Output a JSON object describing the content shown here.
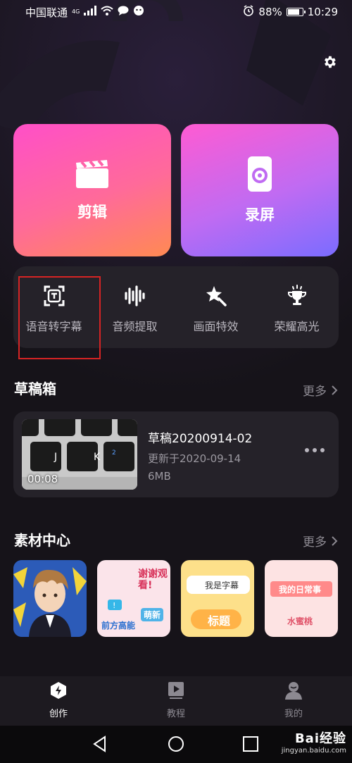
{
  "status_bar": {
    "carrier": "中国联通",
    "network": "4G",
    "battery": "88%",
    "battery_level": 0.88,
    "time": "10:29"
  },
  "main_cards": [
    {
      "label": "剪辑",
      "icon": "clapperboard-icon"
    },
    {
      "label": "录屏",
      "icon": "phone-record-icon"
    }
  ],
  "tools": [
    {
      "label": "语音转字幕",
      "icon": "text-recognition-icon"
    },
    {
      "label": "音频提取",
      "icon": "audio-wave-icon"
    },
    {
      "label": "画面特效",
      "icon": "magic-star-icon"
    },
    {
      "label": "荣耀高光",
      "icon": "trophy-icon"
    }
  ],
  "drafts": {
    "title": "草稿箱",
    "more": "更多",
    "item": {
      "name": "草稿20200914-02",
      "updated": "更新于2020-09-14",
      "size": "6MB",
      "duration": "00:08",
      "keys": [
        "J",
        "K",
        "2"
      ]
    }
  },
  "materials": {
    "title": "素材中心",
    "more": "更多",
    "items": [
      {
        "name": "anime-character"
      },
      {
        "name": "前方高能",
        "text": "前方高能",
        "text2": "谢谢观看!",
        "text3": "萌新"
      },
      {
        "name": "标题",
        "text": "我是字幕",
        "text2": "标题"
      },
      {
        "name": "水蜜桃",
        "text": "我的日常事",
        "text2": "水蜜桃"
      }
    ]
  },
  "bottom_nav": [
    {
      "label": "创作",
      "icon": "create-bolt-icon",
      "active": true
    },
    {
      "label": "教程",
      "icon": "tutorial-play-icon",
      "active": false
    },
    {
      "label": "我的",
      "icon": "profile-person-icon",
      "active": false
    }
  ],
  "watermark": {
    "text": "Bai经验",
    "sub": "jingyan.baidu.com"
  },
  "colors": {
    "background": "#161319",
    "card_bg": "#252229",
    "highlight_border": "#d62424"
  }
}
